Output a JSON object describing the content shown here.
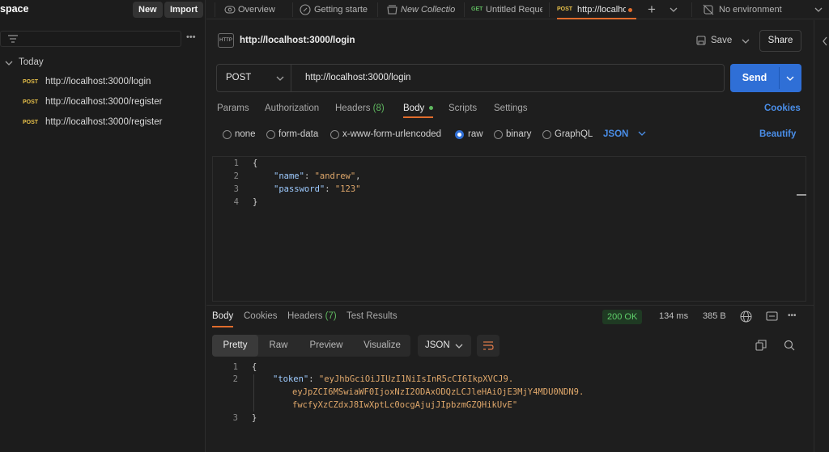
{
  "sidebar": {
    "title": "space",
    "new_label": "New",
    "import_label": "Import",
    "more_icon": "•••",
    "group_label": "Today",
    "items": [
      {
        "method": "POST",
        "url": "http://localhost:3000/login"
      },
      {
        "method": "POST",
        "url": "http://localhost:3000/register"
      },
      {
        "method": "POST",
        "url": "http://localhost:3000/register"
      }
    ]
  },
  "tabs": {
    "items": [
      {
        "label": "Overview"
      },
      {
        "label": "Getting starte"
      },
      {
        "label": "New Collectio"
      },
      {
        "method": "GET",
        "label": "Untitled Reque"
      },
      {
        "method": "POST",
        "label": "http://localho"
      }
    ],
    "add_label": "+",
    "environment_label": "No environment"
  },
  "request": {
    "title": "http://localhost:3000/login",
    "save_label": "Save",
    "share_label": "Share",
    "method": "POST",
    "url": "http://localhost:3000/login",
    "send_label": "Send",
    "subtabs": [
      "Params",
      "Authorization",
      "Headers",
      "Body",
      "Scripts",
      "Settings"
    ],
    "headers_count": "(8)",
    "cookies_label": "Cookies",
    "body_types": [
      "none",
      "form-data",
      "x-www-form-urlencoded",
      "raw",
      "binary",
      "GraphQL"
    ],
    "body_format": "JSON",
    "beautify_label": "Beautify",
    "body_lines": [
      "1",
      "2",
      "3",
      "4"
    ],
    "body_code": {
      "l1": "{",
      "name_key": "\"name\"",
      "name_val": "\"andrew\"",
      "pw_key": "\"password\"",
      "pw_val": "\"123\"",
      "l4": "}"
    }
  },
  "response": {
    "tabs": [
      "Body",
      "Cookies",
      "Headers",
      "Test Results"
    ],
    "headers_count": "(7)",
    "status": "200 OK",
    "time": "134 ms",
    "size": "385 B",
    "views": [
      "Pretty",
      "Raw",
      "Preview",
      "Visualize"
    ],
    "format": "JSON",
    "lines": [
      "1",
      "2",
      "3"
    ],
    "code": {
      "l1": "{",
      "token_key": "\"token\"",
      "token_1": "\"eyJhbGciOiJIUzI1NiIsInR5cCI6IkpXVCJ9.",
      "token_2": "eyJpZCI6MSwiaWF0IjoxNzI2ODAxODQzLCJleHAiOjE3MjY4MDU0NDN9.",
      "token_3": "fwcfyXzCZdxJ8IwXptLc0ocgAjujJIpbzmGZQHikUvE\"",
      "l3": "}"
    }
  },
  "colors": {
    "accent": "#2f6fd6",
    "post": "#e8c14a",
    "get": "#5fb85f",
    "status_ok": "#4caf50",
    "tab_active": "#e06c2c"
  }
}
